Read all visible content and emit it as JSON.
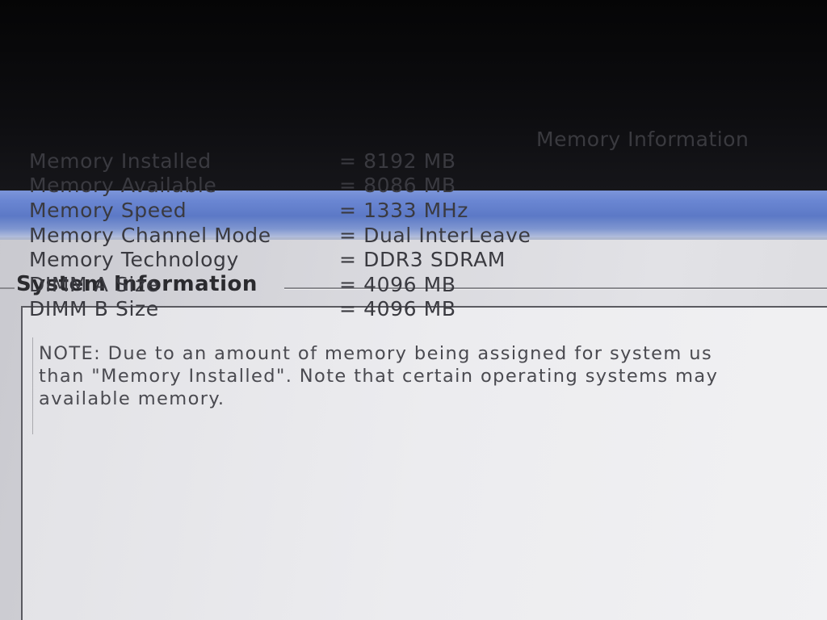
{
  "section_title": "System Information",
  "panel_title": "Memory Information",
  "rows": [
    {
      "label": "Memory Installed",
      "value": "= 8192 MB"
    },
    {
      "label": "Memory Available",
      "value": "= 8086 MB"
    },
    {
      "label": "Memory Speed",
      "value": "= 1333 MHz"
    },
    {
      "label": "Memory Channel Mode",
      "value": "= Dual InterLeave"
    },
    {
      "label": "Memory Technology",
      "value": "= DDR3 SDRAM"
    },
    {
      "label": "DIMM A Size",
      "value": "= 4096 MB"
    },
    {
      "label": "DIMM B Size",
      "value": "= 4096 MB"
    }
  ],
  "note": {
    "line1": "NOTE: Due to an amount of memory being assigned for system us",
    "line2": "than \"Memory Installed\". Note that certain operating systems may",
    "line3": "available memory."
  },
  "colors": {
    "title_bar": "#6a86d2",
    "panel_background": "#ececef",
    "text": "#3a3a40"
  }
}
